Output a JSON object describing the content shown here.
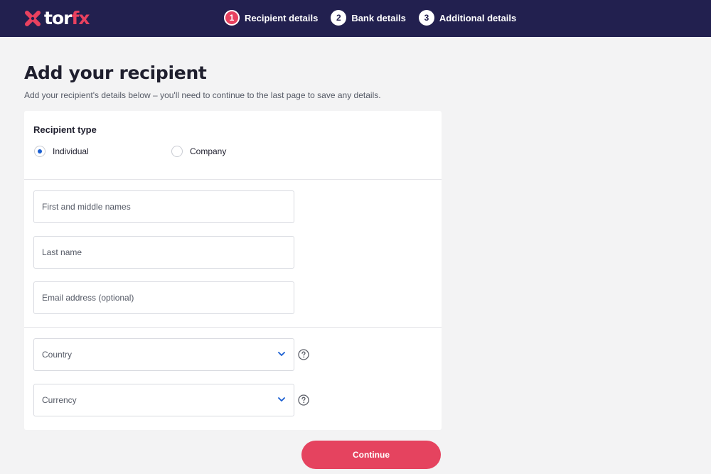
{
  "brand": {
    "name_part1": "tor",
    "name_part2": "fx",
    "accent_color": "#e8415f",
    "header_color": "#22204f"
  },
  "steps": [
    {
      "number": "1",
      "label": "Recipient details",
      "active": true
    },
    {
      "number": "2",
      "label": "Bank details",
      "active": false
    },
    {
      "number": "3",
      "label": "Additional details",
      "active": false
    }
  ],
  "page": {
    "title": "Add your recipient",
    "subtitle": "Add your recipient's details below – you'll need to continue to the last page to save any details."
  },
  "recipient_type": {
    "label": "Recipient type",
    "options": [
      {
        "label": "Individual",
        "selected": true
      },
      {
        "label": "Company",
        "selected": false
      }
    ]
  },
  "fields": {
    "first_names": {
      "placeholder": "First and middle names",
      "value": ""
    },
    "last_name": {
      "placeholder": "Last name",
      "value": ""
    },
    "email": {
      "placeholder": "Email address (optional)",
      "value": ""
    },
    "country": {
      "placeholder": "Country",
      "icon": "chevron-down-icon",
      "help_icon": "question-circle-icon"
    },
    "currency": {
      "placeholder": "Currency",
      "icon": "chevron-down-icon",
      "help_icon": "question-circle-icon"
    }
  },
  "actions": {
    "continue_label": "Continue"
  }
}
